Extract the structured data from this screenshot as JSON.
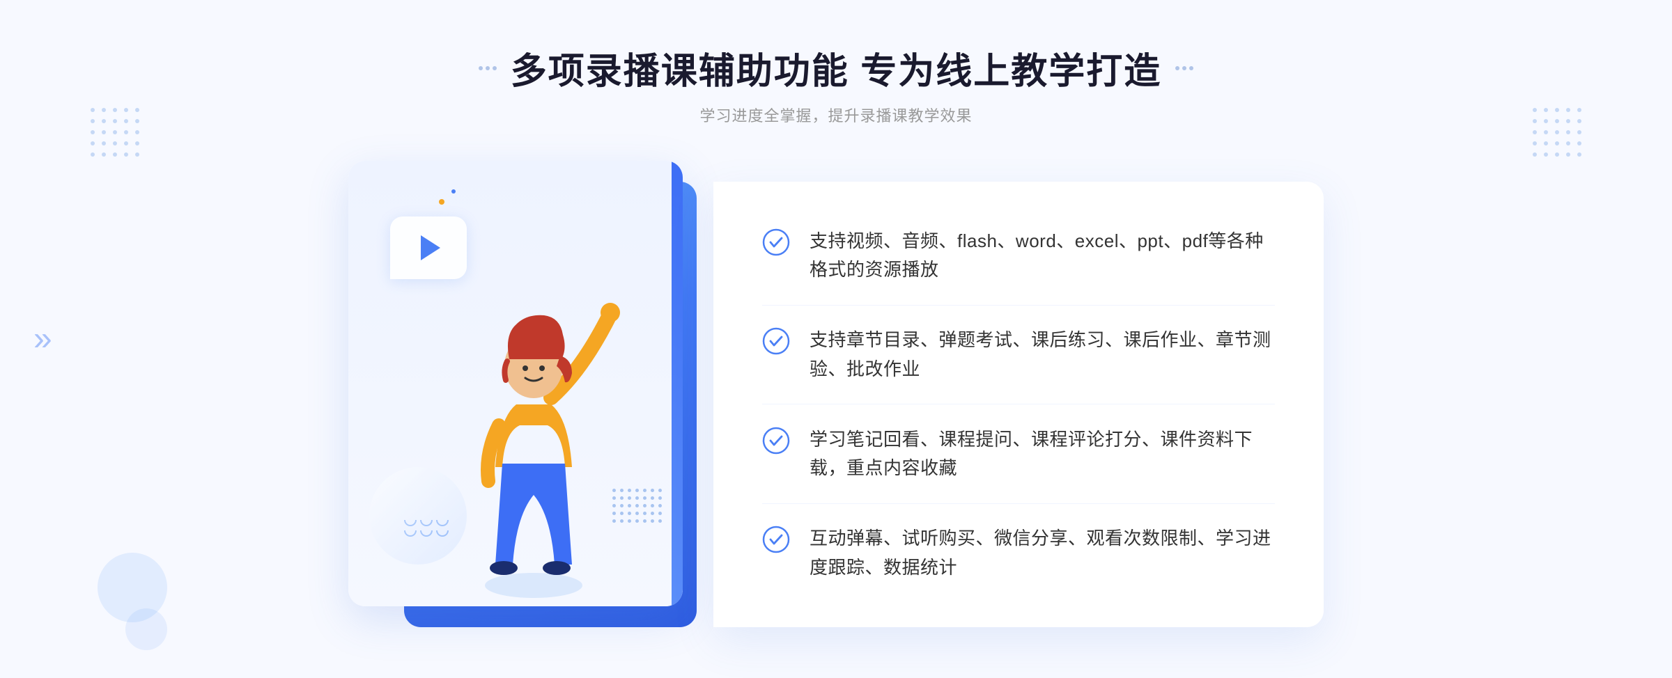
{
  "page": {
    "background": "#f7f9ff"
  },
  "header": {
    "main_title": "多项录播课辅助功能 专为线上教学打造",
    "sub_title": "学习进度全掌握，提升录播课教学效果"
  },
  "features": [
    {
      "id": 1,
      "text": "支持视频、音频、flash、word、excel、ppt、pdf等各种格式的资源播放"
    },
    {
      "id": 2,
      "text": "支持章节目录、弹题考试、课后练习、课后作业、章节测验、批改作业"
    },
    {
      "id": 3,
      "text": "学习笔记回看、课程提问、课程评论打分、课件资料下载，重点内容收藏"
    },
    {
      "id": 4,
      "text": "互动弹幕、试听购买、微信分享、观看次数限制、学习进度跟踪、数据统计"
    }
  ],
  "decorators": {
    "left_chevron": "»",
    "check_color": "#4a7ff5"
  }
}
